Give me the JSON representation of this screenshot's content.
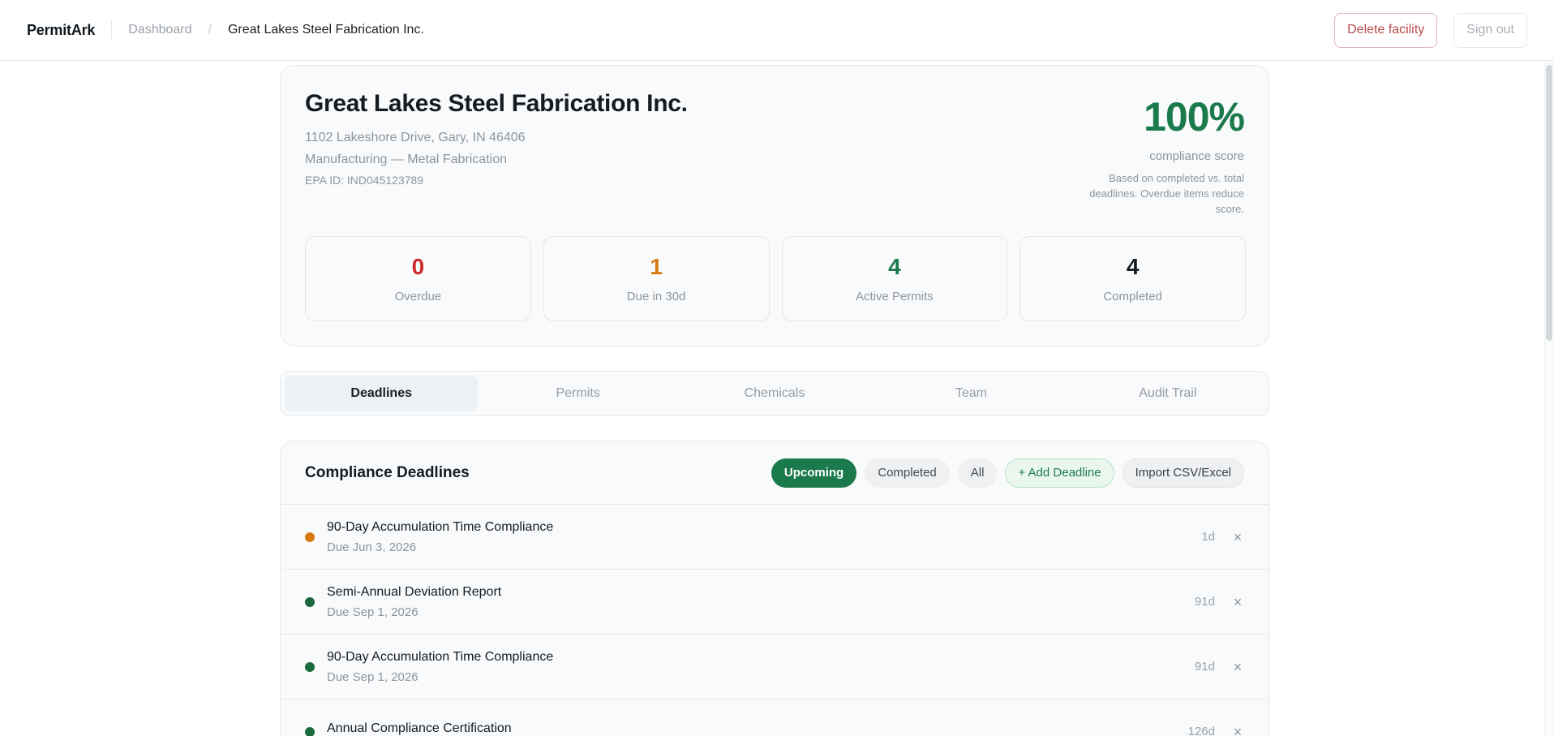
{
  "header": {
    "brand": "PermitArk",
    "breadcrumb_root": "Dashboard",
    "breadcrumb_separator": "/",
    "breadcrumb_current": "Great Lakes Steel Fabrication Inc.",
    "delete_label": "Delete facility",
    "signout_label": "Sign out"
  },
  "facility": {
    "name": "Great Lakes Steel Fabrication Inc.",
    "address": "1102 Lakeshore Drive, Gary, IN 46406",
    "industry": "Manufacturing — Metal Fabrication",
    "epa_id": "EPA ID: IND045123789",
    "score": "100%",
    "score_label": "compliance score",
    "score_note": "Based on completed vs. total deadlines. Overdue items reduce score."
  },
  "stats": [
    {
      "value": "0",
      "label": "Overdue",
      "color": "#cc2b2b"
    },
    {
      "value": "1",
      "label": "Due in 30d",
      "color": "#d87a12"
    },
    {
      "value": "4",
      "label": "Active Permits",
      "color": "#1b7a4c"
    },
    {
      "value": "4",
      "label": "Completed",
      "color": "#151b21"
    }
  ],
  "tabs": [
    {
      "label": "Deadlines",
      "active": true
    },
    {
      "label": "Permits",
      "active": false
    },
    {
      "label": "Chemicals",
      "active": false
    },
    {
      "label": "Team",
      "active": false
    },
    {
      "label": "Audit Trail",
      "active": false
    }
  ],
  "deadlines": {
    "title": "Compliance Deadlines",
    "filters": {
      "upcoming": "Upcoming",
      "completed": "Completed",
      "all": "All",
      "add": "+ Add Deadline",
      "import": "Import CSV/Excel"
    },
    "active_filter": "Upcoming",
    "rows": [
      {
        "title": "90-Day Accumulation Time Compliance",
        "due": "Due Jun 3, 2026",
        "days": "1d",
        "status_color": "#d87a12",
        "remove": "×"
      },
      {
        "title": "Semi-Annual Deviation Report",
        "due": "Due Sep 1, 2026",
        "days": "91d",
        "status_color": "#1b6a3e",
        "remove": "×"
      },
      {
        "title": "90-Day Accumulation Time Compliance",
        "due": "Due Sep 1, 2026",
        "days": "91d",
        "status_color": "#1b6a3e",
        "remove": "×"
      },
      {
        "title": "Annual Compliance Certification",
        "due": "",
        "days": "126d",
        "status_color": "#1b6a3e",
        "remove": "×"
      }
    ]
  }
}
